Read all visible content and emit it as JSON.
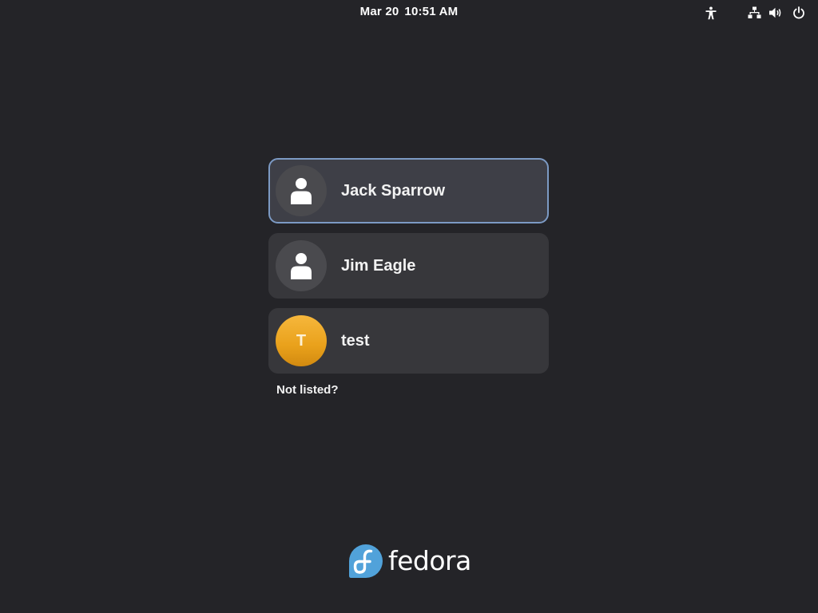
{
  "top_bar": {
    "date": "Mar 20",
    "time": "10:51 AM",
    "icons": [
      "accessibility-icon",
      "network-icon",
      "volume-icon",
      "power-icon"
    ]
  },
  "users": [
    {
      "name": "Jack Sparrow",
      "avatar": "person-icon",
      "selected": true
    },
    {
      "name": "Jim Eagle",
      "avatar": "person-icon",
      "selected": false
    },
    {
      "name": "test",
      "avatar_initial": "T",
      "selected": false
    }
  ],
  "not_listed_label": "Not listed?",
  "logo": {
    "wordmark": "fedora"
  },
  "colors": {
    "background": "#242428",
    "card": "#37373b",
    "selected_border": "#7c9ac4",
    "avatar_initial_bg": "#e9a11b",
    "fedora_blue": "#51a2da"
  }
}
